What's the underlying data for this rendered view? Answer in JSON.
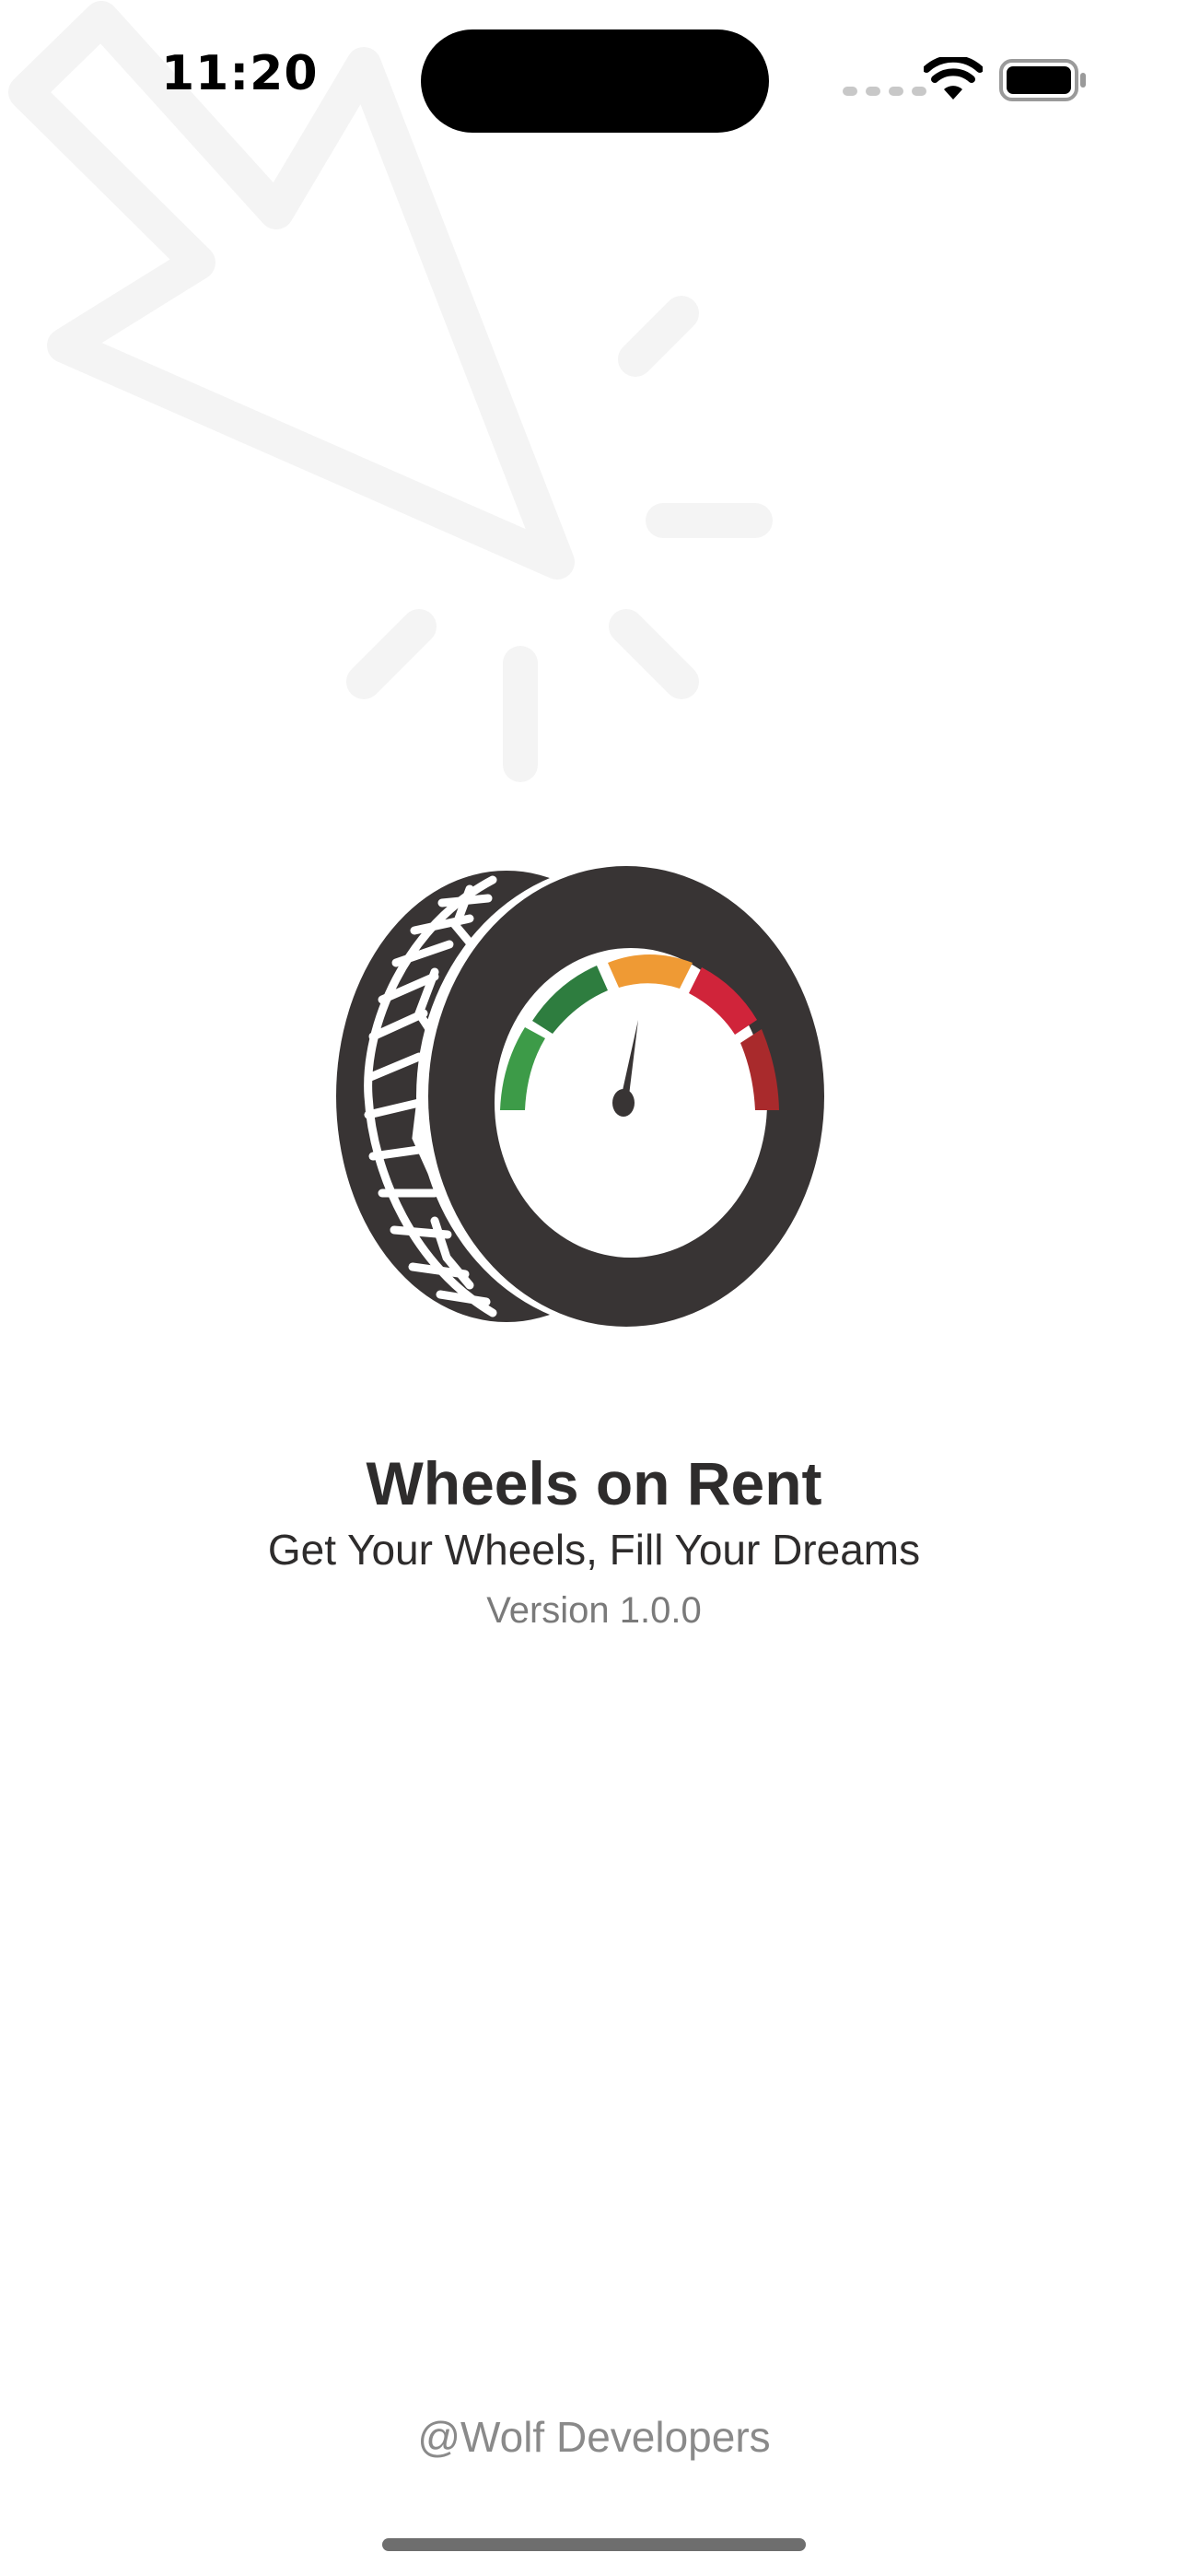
{
  "status_bar": {
    "time": "11:20",
    "signal_icon": "cellular-signal-icon",
    "wifi_icon": "wifi-icon",
    "battery_icon": "battery-full-icon"
  },
  "background": {
    "decoration_icon": "touch-tap-cursor-icon"
  },
  "splash": {
    "logo_icon": "tire-speedometer-logo",
    "title": "Wheels on Rent",
    "tagline": "Get Your Wheels, Fill Your Dreams",
    "version": "Version 1.0.0"
  },
  "footer": {
    "credit": "@Wolf Developers"
  },
  "colors": {
    "background": "#ffffff",
    "tire": "#383434",
    "gauge_green": "#3d9b48",
    "gauge_dark_green": "#2e7d3f",
    "gauge_orange": "#ef9a34",
    "gauge_red": "#d0243a",
    "gauge_dark_red": "#a92a2c",
    "text_primary": "#2e2c2c",
    "text_secondary": "#7a7a7a"
  }
}
